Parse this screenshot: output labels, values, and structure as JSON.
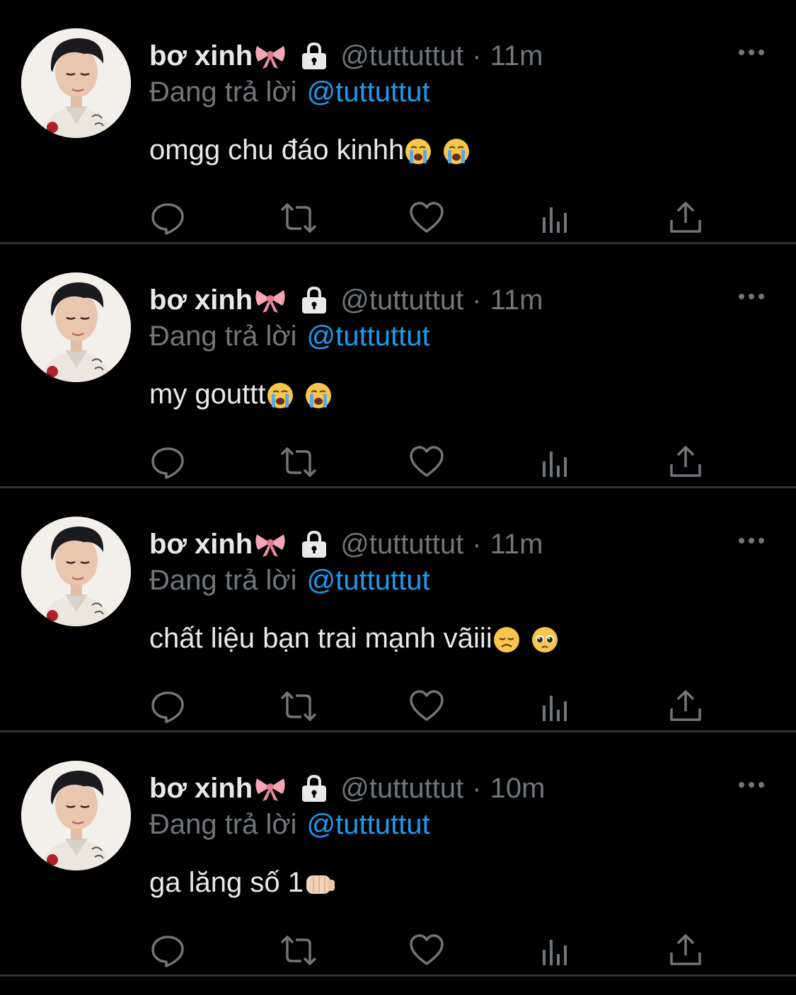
{
  "tweets": [
    {
      "name": "bơ xinh",
      "name_emoji": "ribbon-icon",
      "handle": "@tuttuttut",
      "separator": "·",
      "time": "11m",
      "reply_prefix": "Đang trả lời",
      "reply_handle": "@tuttuttut",
      "text": "omgg chu đáo kinhh",
      "emojis": [
        "loudly-crying-face-icon",
        "loudly-crying-face-icon"
      ]
    },
    {
      "name": "bơ xinh",
      "name_emoji": "ribbon-icon",
      "handle": "@tuttuttut",
      "separator": "·",
      "time": "11m",
      "reply_prefix": "Đang trả lời",
      "reply_handle": "@tuttuttut",
      "text": "my gouttt",
      "emojis": [
        "loudly-crying-face-icon",
        "loudly-crying-face-icon"
      ]
    },
    {
      "name": "bơ xinh",
      "name_emoji": "ribbon-icon",
      "handle": "@tuttuttut",
      "separator": "·",
      "time": "11m",
      "reply_prefix": "Đang trả lời",
      "reply_handle": "@tuttuttut",
      "text": "chất liệu bạn trai mạnh vãiii",
      "emojis": [
        "disappointed-face-icon",
        "pleading-face-icon"
      ]
    },
    {
      "name": "bơ xinh",
      "name_emoji": "ribbon-icon",
      "handle": "@tuttuttut",
      "separator": "·",
      "time": "10m",
      "reply_prefix": "Đang trả lời",
      "reply_handle": "@tuttuttut",
      "text": "ga lăng số 1",
      "emojis": [
        "oncoming-fist-icon"
      ]
    }
  ],
  "colors": {
    "background": "#000000",
    "text": "#e7e9ea",
    "secondary": "#71767b",
    "link": "#1d9bf0",
    "divider": "#2f3336"
  },
  "icons": {
    "more": "more-horizontal-icon",
    "lock": "lock-icon",
    "actions": [
      "reply-icon",
      "retweet-icon",
      "like-icon",
      "views-icon",
      "share-icon"
    ]
  }
}
